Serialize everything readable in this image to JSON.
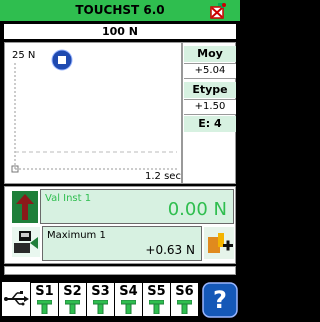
{
  "window": {
    "title": "TOUCHST 6.0"
  },
  "display": {
    "current_value": "100 N"
  },
  "graph": {
    "y_label": "25 N",
    "x_label": "1.2 sec",
    "control_icon": "stop-icon"
  },
  "stats": {
    "moy_label": "Moy",
    "moy_value": "+5.04",
    "etype_label": "Etype",
    "etype_value": "+1.50",
    "e_count": "E: 4"
  },
  "instant": {
    "label": "Val Inst 1",
    "value": "0.00 N"
  },
  "maximum": {
    "label": "Maximum 1",
    "value": "+0.63 N"
  },
  "sensors": [
    "S1",
    "S2",
    "S3",
    "S4",
    "S5",
    "S6"
  ],
  "help": {
    "label": "?"
  },
  "colors": {
    "accent": "#2fbe4f",
    "panel_background": "#d7f1e1",
    "help_blue": "#1558b7"
  }
}
